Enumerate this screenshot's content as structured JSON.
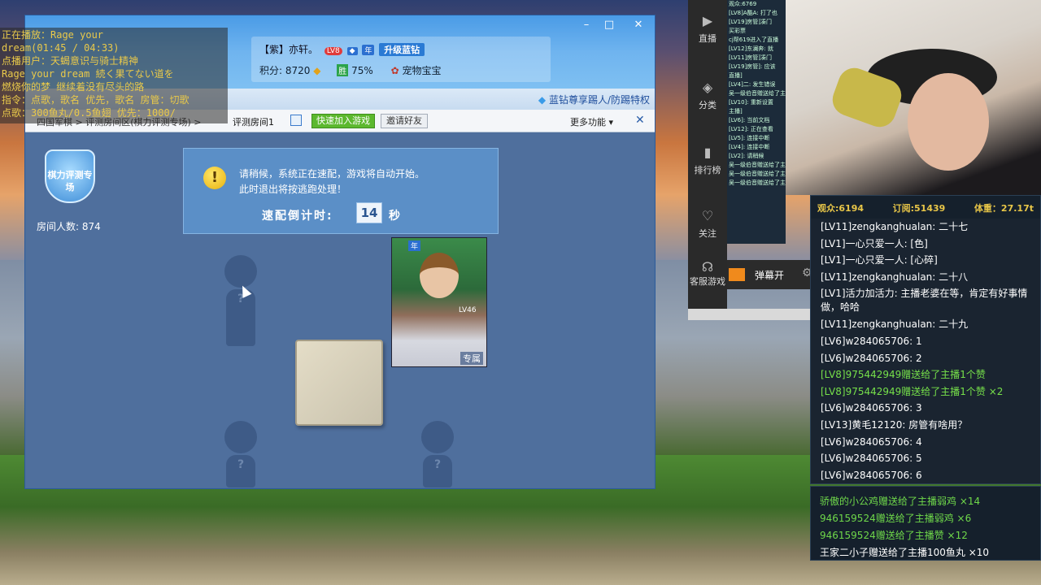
{
  "song": {
    "lines": [
      "正在播放：Rage your",
      "dream(01:45 / 04:33)",
      "点播用户：天蝎意识与骑士精神",
      "Rage your dream 続く果てない道を",
      "燃烧你的梦 继续着没有尽头的路",
      "指令：点歌，歌名  优先，歌名 房管：切歌",
      "点歌：300鱼丸/0.5鱼翅      优先：1000/"
    ]
  },
  "game": {
    "user_name": "【紫】亦轩。",
    "lv_badge": "LV8",
    "year_badge": "年",
    "upgrade_label": "升级蓝钻",
    "score": "积分: 8720",
    "win_rate": "75%",
    "rate_icon": "胜",
    "pet_label": "宠物宝宝",
    "vip_link": "蓝钻尊享踢人/防踢特权",
    "breadcrumb": "四国军棋 > 评测房间区(棋力评测专场) >",
    "current_room": "评测房间1",
    "quick_join": "快速加入游戏",
    "invite_friend": "邀请好友",
    "more": "更多功能",
    "shield_text": "棋力评测专场",
    "room_count": "房间人数: 874",
    "notice_line1": "请稍候，系统正在速配，游戏将自动开始。",
    "notice_line2": "此时退出将按逃跑处理！",
    "countdown_label": "速配倒计时:",
    "countdown_value": "14",
    "countdown_unit": "秒",
    "card_year": "年",
    "card_lv": "LV46",
    "card_exclusive": "专属"
  },
  "sidebar": {
    "items": [
      "直播",
      "分类",
      "排行榜",
      "关注",
      "客服游戏"
    ]
  },
  "mini_chat": [
    "观众:6769",
    "[LV8]A酷A: 打了也",
    "[LV19]房管]凑门",
    "买彩票",
    "cj帮619进入了直播",
    "[LV12]东澜奔: 就",
    "[LV11]房管]凑门",
    "[LV19]房管]: 应该",
    "直播]",
    "[LV4]二: 发生错误",
    "吴一级伯音赠送给了主播",
    "[LV10]: 重新设置",
    "主播]",
    "[LV6]: 当前文档",
    "[LV12]: 正在查看",
    "[LV5]: 连接中断",
    "[LV4]: 连接中断",
    "[LV2]: 请稍候",
    "吴一级伯音赠送给了主播",
    "吴一级伯音赠送给了主播",
    "吴一级伯音赠送给了主播"
  ],
  "barrage": {
    "label": "弹幕开"
  },
  "chat": {
    "viewers": "观众:6194",
    "subs": "订阅:51439",
    "weight": "体重：27.17t",
    "lines": [
      {
        "text": "[LV11]zengkanghualan: 二十七",
        "style": "white"
      },
      {
        "text": "[LV1]一心只爱一人: [色]",
        "style": "white"
      },
      {
        "text": "[LV1]一心只爱一人: [心碎]",
        "style": "white"
      },
      {
        "text": "[LV11]zengkanghualan: 二十八",
        "style": "white"
      },
      {
        "text": "[LV1]活力加活力: 主播老婆在等，肯定有好事情做，哈哈",
        "style": "wrap"
      },
      {
        "text": "[LV11]zengkanghualan: 二十九",
        "style": "white"
      },
      {
        "text": "[LV6]w284065706: 1",
        "style": "white"
      },
      {
        "text": "[LV6]w284065706: 2",
        "style": "white"
      },
      {
        "text": "[LV8]975442949赠送给了主播1个赞",
        "style": "green"
      },
      {
        "text": "[LV8]975442949赠送给了主播1个赞 ×2",
        "style": "green"
      },
      {
        "text": "[LV6]w284065706: 3",
        "style": "white"
      },
      {
        "text": "[LV13]黄毛12120: 房管有啥用？",
        "style": "white"
      },
      {
        "text": "[LV6]w284065706: 4",
        "style": "white"
      },
      {
        "text": "[LV6]w284065706: 5",
        "style": "white"
      },
      {
        "text": "[LV6]w284065706: 6",
        "style": "white"
      }
    ]
  },
  "gifts": [
    {
      "text": "骄傲的小公鸡赠送给了主播弱鸡 ×14",
      "style": "green"
    },
    {
      "text": "946159524赠送给了主播弱鸡 ×6",
      "style": "green"
    },
    {
      "text": "946159524赠送给了主播赞 ×12",
      "style": "green"
    },
    {
      "text": "王家二小子赠送给了主播100鱼丸 ×10",
      "style": "white"
    }
  ],
  "colors": {
    "accent_green": "#76e04a",
    "stats_gold": "#e8c648",
    "song_yellow": "#e9c94a"
  }
}
